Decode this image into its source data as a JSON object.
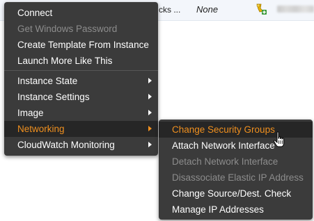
{
  "background": {
    "truncated_text": "cks ...",
    "value": "None",
    "icon": "key-pin-icon"
  },
  "main_menu": {
    "items": [
      {
        "label": "Connect"
      },
      {
        "label": "Get Windows Password",
        "disabled": true
      },
      {
        "label": "Create Template From Instance"
      },
      {
        "label": "Launch More Like This"
      },
      {
        "label": "Instance State",
        "submenu": true
      },
      {
        "label": "Instance Settings",
        "submenu": true
      },
      {
        "label": "Image",
        "submenu": true
      },
      {
        "label": "Networking",
        "submenu": true,
        "active": true
      },
      {
        "label": "CloudWatch Monitoring",
        "submenu": true
      }
    ]
  },
  "networking_submenu": {
    "items": [
      {
        "label": "Change Security Groups",
        "active": true
      },
      {
        "label": "Attach Network Interface"
      },
      {
        "label": "Detach Network Interface",
        "disabled": true
      },
      {
        "label": "Disassociate Elastic IP Address",
        "disabled": true
      },
      {
        "label": "Change Source/Dest. Check"
      },
      {
        "label": "Manage IP Addresses"
      }
    ]
  },
  "colors": {
    "menu_bg": "#3b3b3b",
    "highlight_bg": "#262626",
    "accent": "#f0901f",
    "disabled_text": "#8c8c8c"
  }
}
